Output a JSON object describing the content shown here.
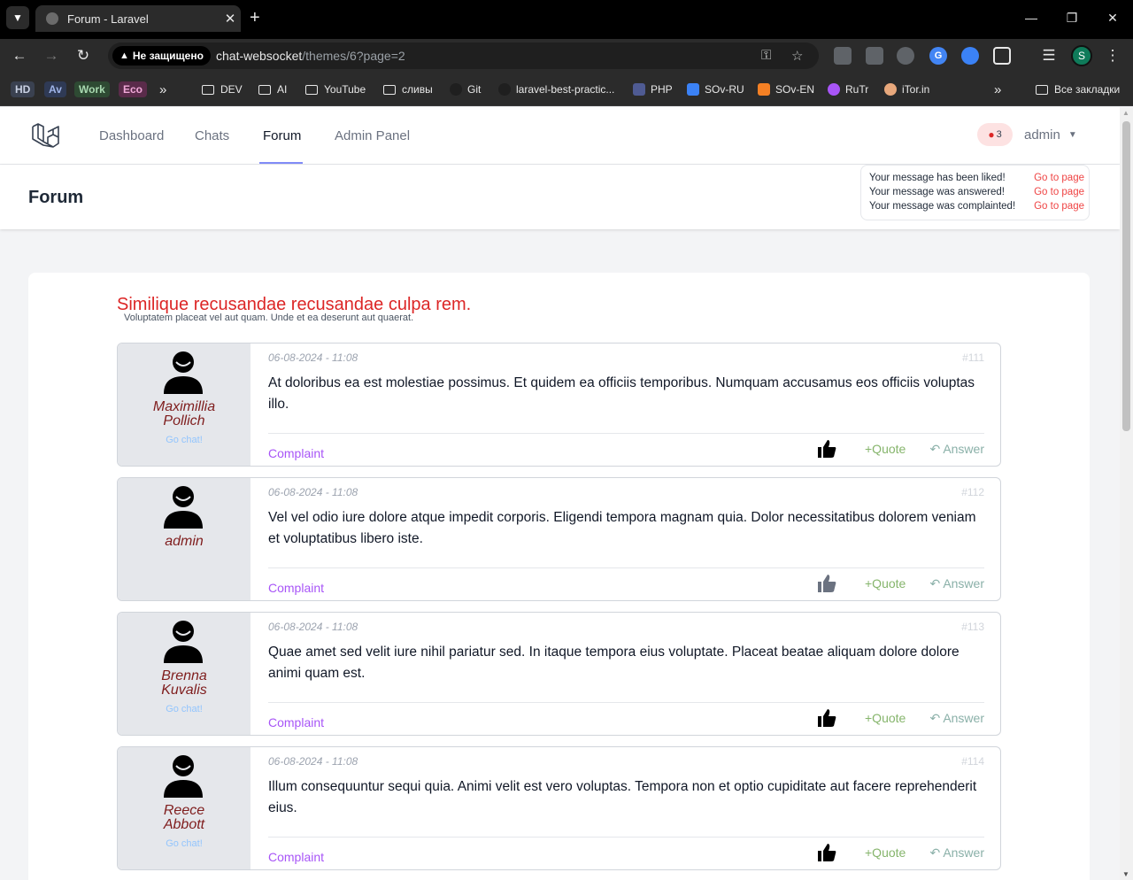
{
  "browser": {
    "tab_title": "Forum - Laravel",
    "security_label": "Не защищено",
    "url_host": "chat-websocket",
    "url_path": "/themes/6?page=2",
    "profile_initial": "S",
    "bookmarks": {
      "hd": "HD",
      "av": "Av",
      "work": "Work",
      "eco": "Eco",
      "dev": "DEV",
      "ai": "AI",
      "youtube": "YouTube",
      "slivy": "сливы",
      "git": "Git",
      "laravel": "laravel-best-practic...",
      "php": "PHP",
      "sov_ru": "SOv-RU",
      "sov_en": "SOv-EN",
      "rutr": "RuTr",
      "itor": "iTor.in",
      "all": "Все закладки"
    }
  },
  "nav": {
    "links": [
      "Dashboard",
      "Chats",
      "Forum",
      "Admin Panel"
    ],
    "notification_count": "3",
    "user": "admin"
  },
  "header": {
    "title": "Forum"
  },
  "notifications": [
    {
      "text": "Your message has been liked!",
      "link": "Go to page"
    },
    {
      "text": "Your message was answered!",
      "link": "Go to page"
    },
    {
      "text": "Your message was complainted!",
      "link": "Go to page"
    }
  ],
  "theme": {
    "title": "Similique recusandae recusandae culpa rem.",
    "subtitle": "Voluptatem placeat vel aut quam. Unde et ea deserunt aut quaerat."
  },
  "posts": [
    {
      "author_line1": "Maximillia",
      "author_line2": "Pollich",
      "go_chat": "Go chat!",
      "date": "06-08-2024 - 11:08",
      "id": "#111",
      "text": "At doloribus ea est molestiae possimus. Et quidem ea officiis temporibus. Numquam accusamus eos officiis voluptas illo.",
      "complaint": "Complaint",
      "quote": "+Quote",
      "answer": "Answer",
      "liked": true
    },
    {
      "author_line1": "admin",
      "author_line2": "",
      "go_chat": "",
      "date": "06-08-2024 - 11:08",
      "id": "#112",
      "text": "Vel vel odio iure dolore atque impedit corporis. Eligendi tempora magnam quia. Dolor necessitatibus dolorem veniam et voluptatibus libero iste.",
      "complaint": "Complaint",
      "quote": "+Quote",
      "answer": "Answer",
      "liked": false
    },
    {
      "author_line1": "Brenna",
      "author_line2": "Kuvalis",
      "go_chat": "Go chat!",
      "date": "06-08-2024 - 11:08",
      "id": "#113",
      "text": "Quae amet sed velit iure nihil pariatur sed. In itaque tempora eius voluptate. Placeat beatae aliquam dolore dolore animi quam est.",
      "complaint": "Complaint",
      "quote": "+Quote",
      "answer": "Answer",
      "liked": true
    },
    {
      "author_line1": "Reece",
      "author_line2": "Abbott",
      "go_chat": "Go chat!",
      "date": "06-08-2024 - 11:08",
      "id": "#114",
      "text": "Illum consequuntur sequi quia. Animi velit est vero voluptas. Tempora non et optio cupiditate aut facere reprehenderit eius.",
      "complaint": "Complaint",
      "quote": "+Quote",
      "answer": "Answer",
      "liked": true
    }
  ]
}
